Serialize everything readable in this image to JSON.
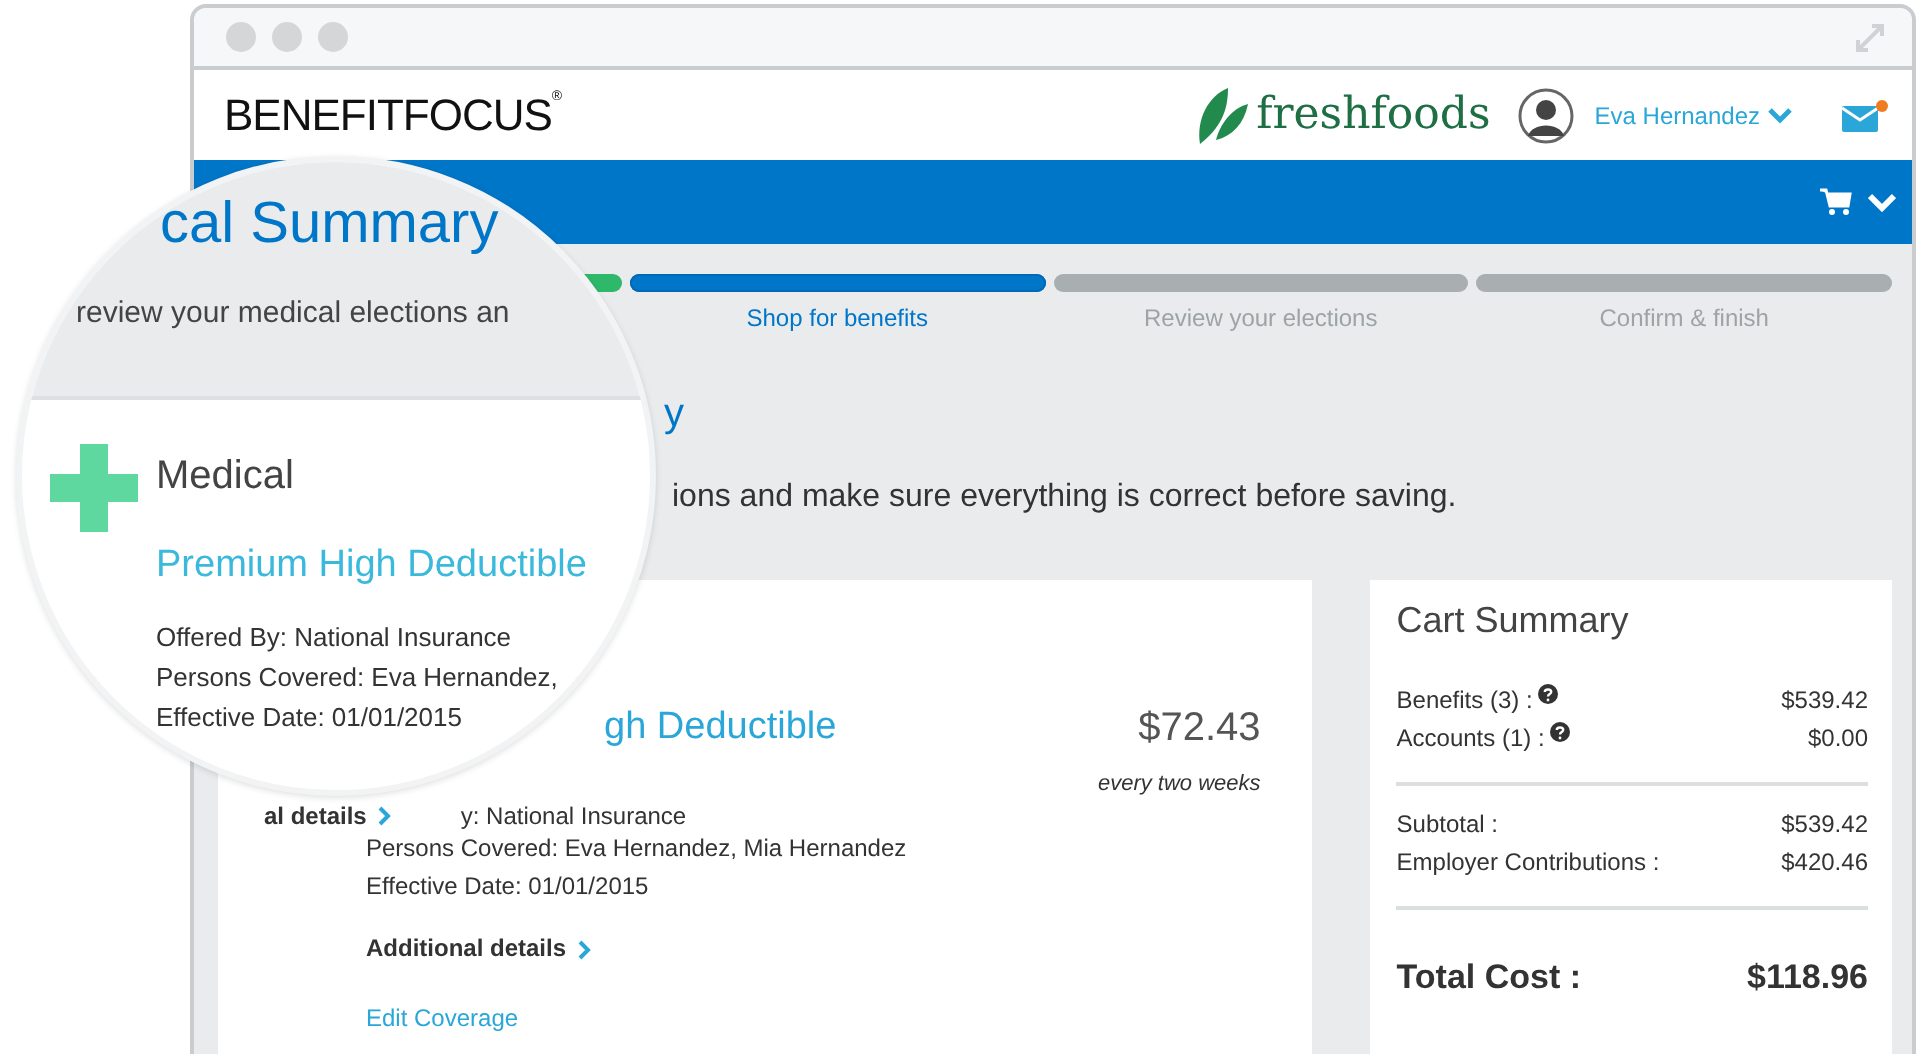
{
  "header": {
    "brand": "BENEFITFOCUS",
    "brand_mark": "®",
    "employer": "freshfoods",
    "user": "Eva Hernandez",
    "mail": {
      "unread": true
    }
  },
  "steps": [
    {
      "done": true,
      "selected": false
    },
    {
      "label": "Shop for benefits",
      "done": false,
      "selected": true
    },
    {
      "label": "Review your elections",
      "done": false,
      "selected": false
    },
    {
      "label": "Confirm & finish",
      "done": false,
      "selected": false
    }
  ],
  "page": {
    "title_fragment": "y",
    "intro_fragment": "ions and make sure everything is correct before saving."
  },
  "plan_card": {
    "title_fragment": "gh Deductible",
    "price": "$72.43",
    "frequency": "every two weeks",
    "details_fragment": "al details",
    "offered_fragment": "y: National Insurance",
    "persons": "Persons Covered: Eva Hernandez, Mia Hernandez",
    "effective": "Effective Date: 01/01/2015",
    "additional": "Additional details",
    "edit": "Edit Coverage"
  },
  "cart": {
    "title": "Cart Summary",
    "groups": [
      [
        {
          "label": "Benefits (3) :",
          "value": "$539.42",
          "help": true
        },
        {
          "label": "Accounts (1) :",
          "value": "$0.00",
          "help": true
        }
      ],
      [
        {
          "label": "Subtotal :",
          "value": "$539.42",
          "help": false
        },
        {
          "label": "Employer Contributions :",
          "value": "$420.46",
          "help": false
        }
      ]
    ],
    "total": {
      "label": "Total Cost :",
      "value": "$118.96"
    }
  },
  "magnifier": {
    "title": "cal Summary",
    "intro": "review your medical elections an",
    "category": "Medical",
    "plan": "Premium High Deductible",
    "lines": [
      "Offered By: National Insurance",
      "Persons Covered: Eva Hernandez,",
      "Effective Date: 01/01/2015"
    ]
  }
}
